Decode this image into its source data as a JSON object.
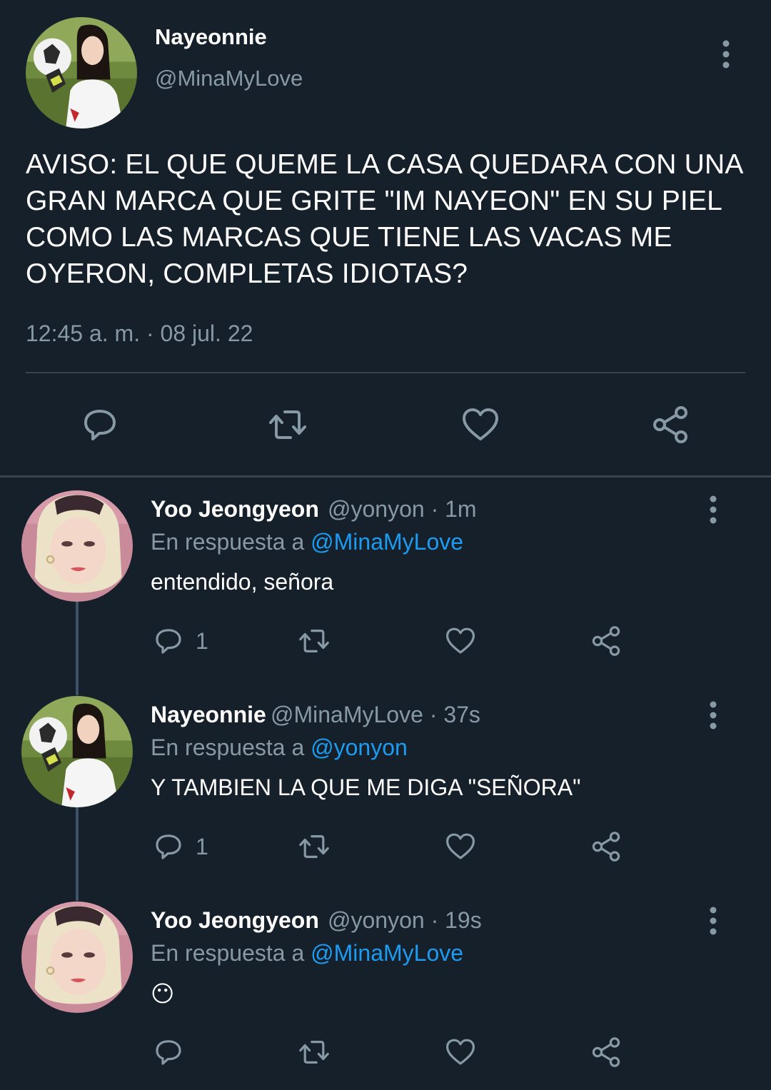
{
  "tweet": {
    "author_name": "Nayeonnie",
    "author_handle": "@MinaMyLove",
    "text": "AVISO: EL QUE QUEME LA CASA QUEDARA CON UNA GRAN MARCA QUE GRITE \"IM NAYEON\" EN SU PIEL COMO LAS MARCAS QUE TIENE LAS VACAS ME OYERON, COMPLETAS IDIOTAS?",
    "timestamp": "12:45 a. m. · 08 jul. 22",
    "more_icon": "more-vertical-icon",
    "actions": [
      "reply-icon",
      "retweet-icon",
      "like-icon",
      "share-icon"
    ]
  },
  "replies": [
    {
      "author_name": "Yoo Jeongyeon",
      "author_handle": "@yonyon",
      "time": "· 1m",
      "in_reply_prefix": "En respuesta a ",
      "in_reply_to": "@MinaMyLove",
      "text": "entendido, señora",
      "reply_count": "1"
    },
    {
      "author_name": "Nayeonnie",
      "author_handle": "@MinaMyLove",
      "time": "· 37s",
      "in_reply_prefix": "En respuesta a ",
      "in_reply_to": "@yonyon",
      "text": "Y TAMBIEN LA QUE ME DIGA \"SEÑORA\"",
      "reply_count": "1"
    },
    {
      "author_name": "Yoo Jeongyeon",
      "author_handle": "@yonyon",
      "time": "· 19s",
      "in_reply_prefix": "En respuesta a ",
      "in_reply_to": "@MinaMyLove",
      "text": "😶",
      "reply_count": ""
    }
  ],
  "colors": {
    "background": "#15202b",
    "secondary_text": "#8899a6",
    "link": "#1d9bf0",
    "divider": "#38444d"
  }
}
